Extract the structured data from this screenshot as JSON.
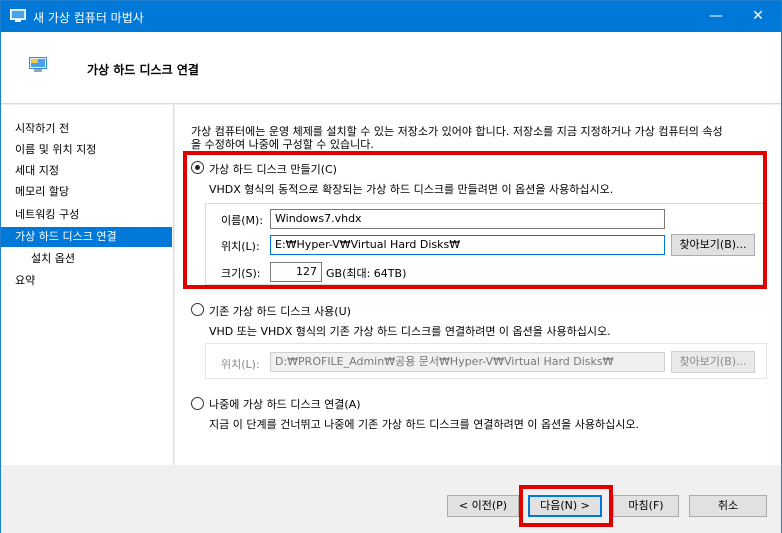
{
  "window": {
    "title": "새 가상 컴퓨터 마법사",
    "controls": {
      "minimize": "—",
      "maximize": "☐",
      "close": "✕"
    }
  },
  "header": {
    "title": "가상 하드 디스크 연결"
  },
  "sidebar": {
    "items": [
      {
        "label": "시작하기 전"
      },
      {
        "label": "이름 및 위치 지정"
      },
      {
        "label": "세대 지정"
      },
      {
        "label": "메모리 할당"
      },
      {
        "label": "네트워킹 구성"
      },
      {
        "label": "가상 하드 디스크 연결"
      },
      {
        "label": "설치 옵션"
      },
      {
        "label": "요약"
      }
    ],
    "active_index": 5
  },
  "main": {
    "intro_line1": "가상 컴퓨터에는 운영 체제를 설치할 수 있는 저장소가 있어야 합니다. 저장소를 지금 지정하거나 가상 컴퓨터의 속성",
    "intro_line2": "을 수정하여 나중에 구성할 수 있습니다.",
    "option_create": {
      "label": "가상 하드 디스크 만들기(C)",
      "description": "VHDX 형식의 동적으로 확장되는 가상 하드 디스크를 만들려면 이 옵션을 사용하십시오.",
      "name_label": "이름(M):",
      "name_value": "Windows7.vhdx",
      "location_label": "위치(L):",
      "location_value": "E:₩Hyper-V₩Virtual Hard Disks₩",
      "browse_label": "찾아보기(B)...",
      "size_label": "크기(S):",
      "size_value": "127",
      "size_unit": "GB(최대: 64TB)"
    },
    "option_existing": {
      "label": "기존 가상 하드 디스크 사용(U)",
      "description": "VHD 또는 VHDX 형식의 기존 가상 하드 디스크를 연결하려면 이 옵션을 사용하십시오.",
      "location_label": "위치(L):",
      "location_value": "D:₩PROFILE_Admin₩공용 문서₩Hyper-V₩Virtual Hard Disks₩",
      "browse_label": "찾아보기(B)..."
    },
    "option_later": {
      "label": "나중에 가상 하드 디스크 연결(A)",
      "description": "지금 이 단계를 건너뛰고 나중에 기존 가상 하드 디스크를 연결하려면 이 옵션을 사용하십시오."
    }
  },
  "footer": {
    "previous": "< 이전(P)",
    "next": "다음(N) >",
    "finish": "마침(F)",
    "cancel": "취소"
  },
  "colors": {
    "titlebar": "#0078d7",
    "selection": "#0078d7",
    "annotation": "#e00000"
  }
}
